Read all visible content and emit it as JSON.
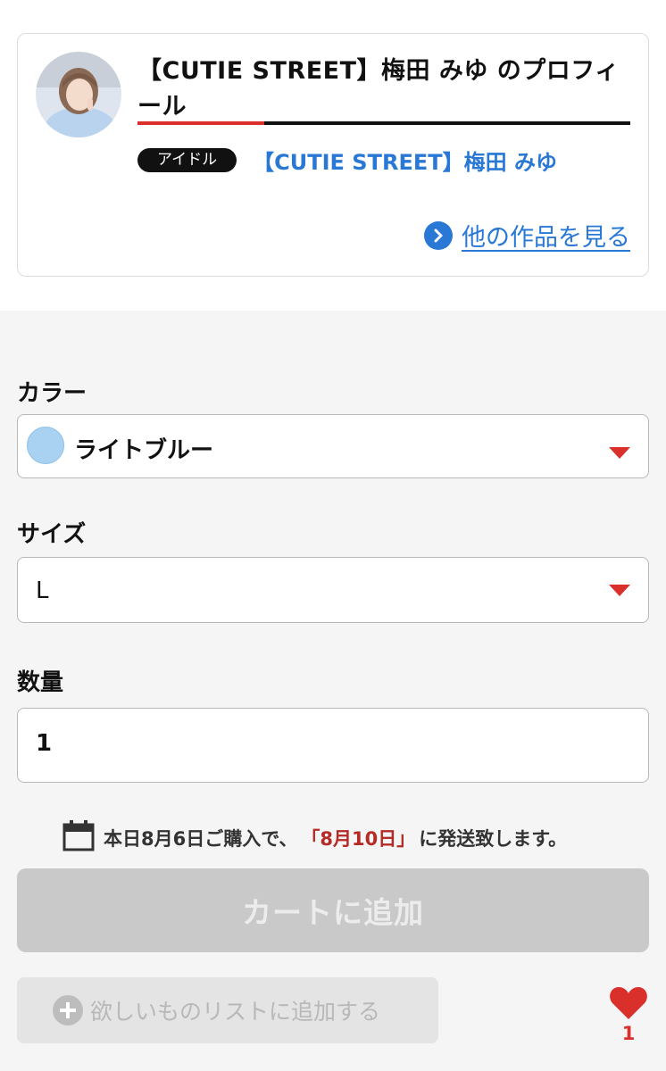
{
  "profile": {
    "title": "【CUTIE STREET】梅田 みゆ のプロフィール",
    "tag": "アイドル",
    "tag_link": "【CUTIE STREET】梅田 みゆ",
    "other_works": "他の作品を見る",
    "avatar_icon": "avatar-photo"
  },
  "options": {
    "color_label": "カラー",
    "color_value": "ライトブルー",
    "color_swatch": "#a9d2f2",
    "size_label": "サイズ",
    "size_value": "L",
    "qty_label": "数量",
    "qty_value": "1"
  },
  "shipping": {
    "prefix": "本日8月6日ご購入で、",
    "date": "「8月10日」",
    "suffix": "に発送致します。"
  },
  "actions": {
    "add_to_cart": "カートに追加",
    "wishlist": "欲しいものリストに追加する",
    "like_count": "1"
  },
  "colors": {
    "accent_red": "#d9302b",
    "link_blue": "#2a78d6",
    "ship_date_red": "#b52a24",
    "disabled_gray": "#c9c9c9"
  }
}
